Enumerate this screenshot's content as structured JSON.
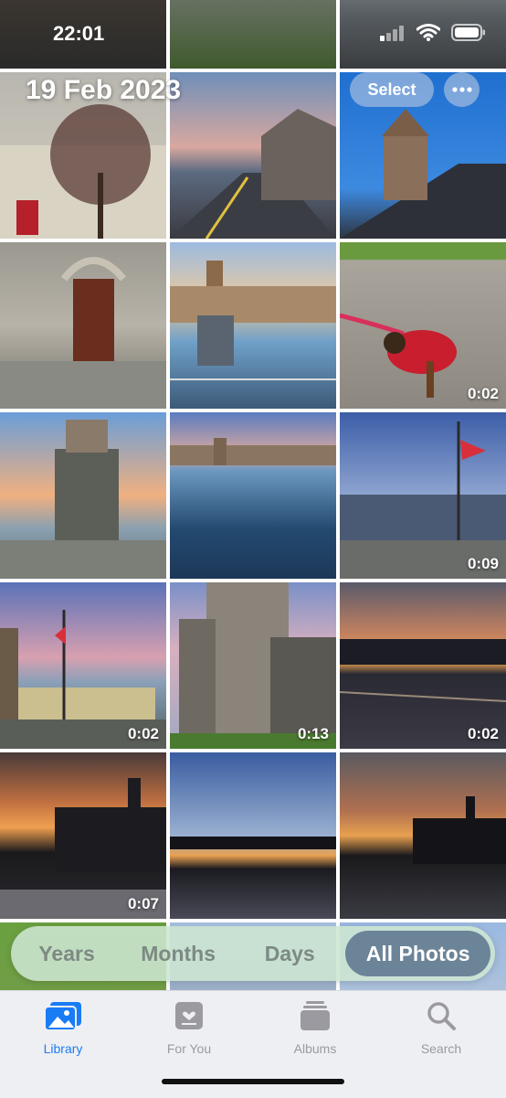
{
  "status": {
    "time": "22:01"
  },
  "header": {
    "date": "19 Feb 2023",
    "select_label": "Select"
  },
  "grid": {
    "durations": {
      "c8": "0:02",
      "c11": "0:09",
      "c12": "0:02",
      "c13": "0:13",
      "c14": "0:02",
      "c15": "0:07"
    }
  },
  "segments": [
    "Years",
    "Months",
    "Days",
    "All Photos"
  ],
  "tabs": [
    {
      "label": "Library",
      "icon": "photo-library-icon"
    },
    {
      "label": "For You",
      "icon": "for-you-icon"
    },
    {
      "label": "Albums",
      "icon": "albums-icon"
    },
    {
      "label": "Search",
      "icon": "search-icon"
    }
  ],
  "colors": {
    "accent": "#1a7cf5",
    "segment_active": "#6c8498"
  }
}
